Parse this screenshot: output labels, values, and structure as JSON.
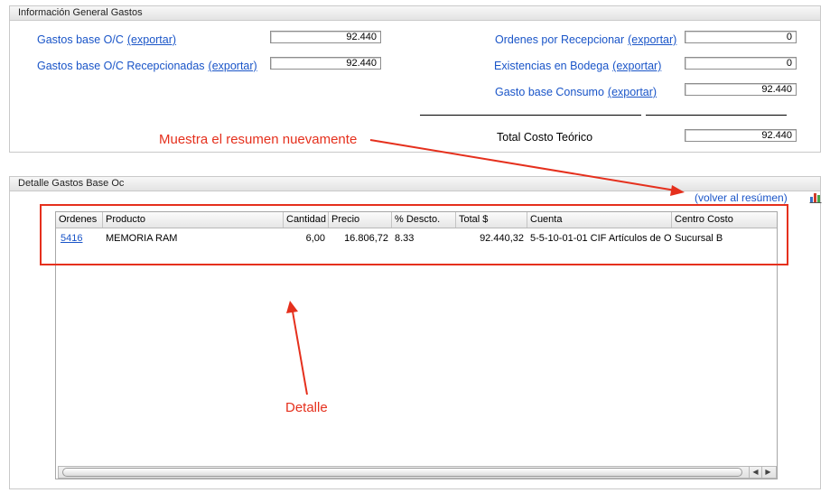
{
  "info_panel": {
    "title": "Información General Gastos",
    "rows": [
      {
        "label": "Gastos base O/C",
        "link": "(exportar)",
        "value": "92.440"
      },
      {
        "label": "Gastos base O/C Recepcionadas",
        "link": "(exportar)",
        "value": "92.440"
      },
      {
        "label": "Ordenes por Recepcionar",
        "link": "(exportar)",
        "value": "0"
      },
      {
        "label": "Existencias en Bodega",
        "link": "(exportar)",
        "value": "0"
      },
      {
        "label": "Gasto base Consumo",
        "link": "(exportar)",
        "value": "92.440"
      }
    ],
    "total_label": "Total Costo Teórico",
    "total_value": "92.440"
  },
  "detail_panel": {
    "title": "Detalle Gastos Base Oc",
    "back_link": "(volver al resúmen)",
    "chart_icon": "bar-chart-icon",
    "columns": [
      "Ordenes",
      "Producto",
      "Cantidad",
      "Precio",
      "% Descto.",
      "Total $",
      "Cuenta",
      "Centro Costo"
    ],
    "rows": [
      {
        "ordenes": "5416",
        "producto": "MEMORIA RAM",
        "cantidad": "6,00",
        "precio": "16.806,72",
        "descto": "8.33",
        "total": "92.440,32",
        "cuenta": "5-5-10-01-01 CIF Artículos de O",
        "centro": "Sucursal B"
      }
    ]
  },
  "annotations": {
    "summary_note": "Muestra el resumen nuevamente",
    "detail_note": "Detalle",
    "color": "#e5301d"
  },
  "colors": {
    "link": "#1a55c8",
    "annotation": "#e5301d"
  }
}
